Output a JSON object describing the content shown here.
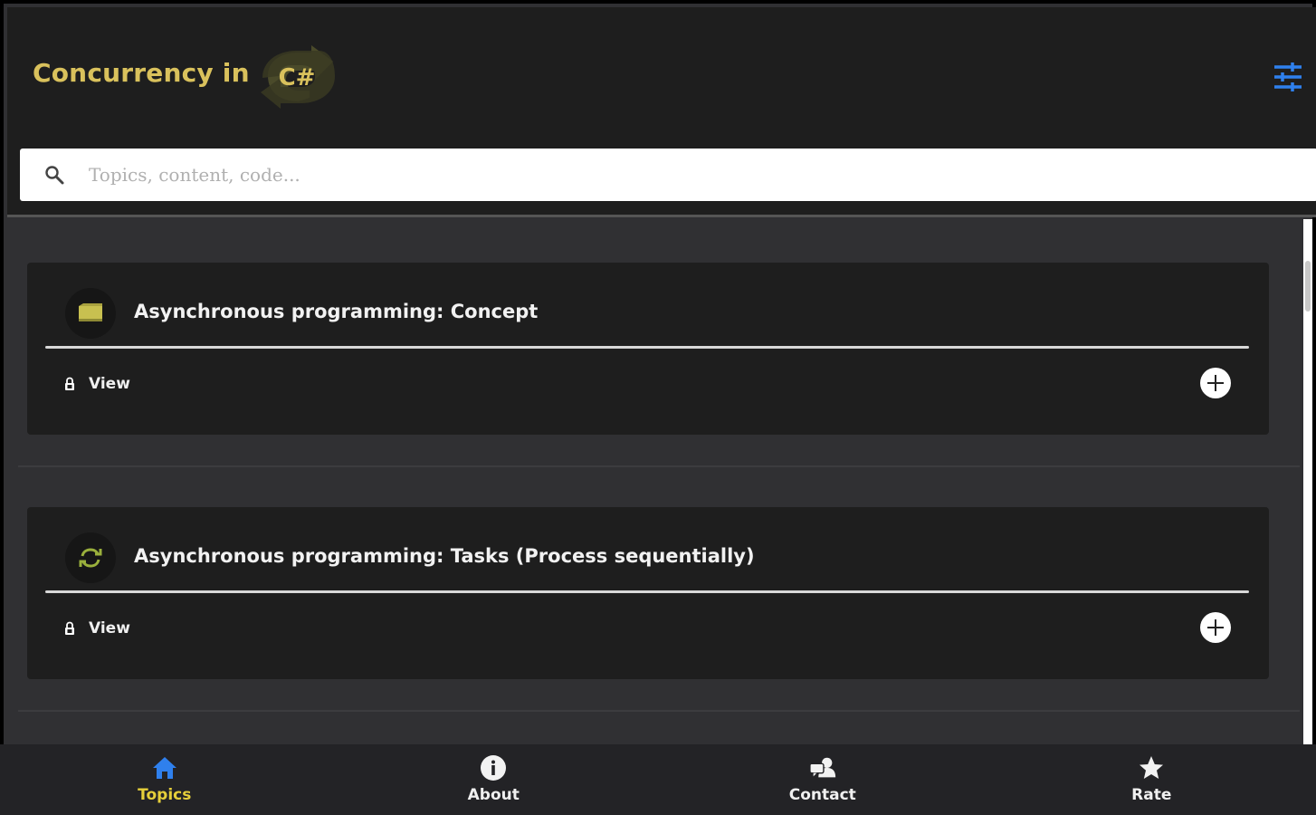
{
  "header": {
    "title": "Concurrency in",
    "logo_text": "C#",
    "filter_icon": "tune-sliders-icon",
    "accent_color": "#d9c15c",
    "filter_color": "#2f80ed"
  },
  "search": {
    "placeholder": "Topics, content, code...",
    "value": "",
    "icon": "search-icon"
  },
  "topics": [
    {
      "title": "Asynchronous programming: Concept",
      "icon": "book-icon",
      "view_label": "View"
    },
    {
      "title": "Asynchronous programming: Tasks (Process sequentially)",
      "icon": "refresh-icon",
      "view_label": "View"
    }
  ],
  "bottom_nav": {
    "items": [
      {
        "label": "Topics",
        "icon": "home-icon",
        "active": true
      },
      {
        "label": "About",
        "icon": "info-icon",
        "active": false
      },
      {
        "label": "Contact",
        "icon": "contact-icon",
        "active": false
      },
      {
        "label": "Rate",
        "icon": "star-icon",
        "active": false
      }
    ],
    "active_color": "#e6cf3a",
    "active_icon_color": "#2f80ed"
  }
}
